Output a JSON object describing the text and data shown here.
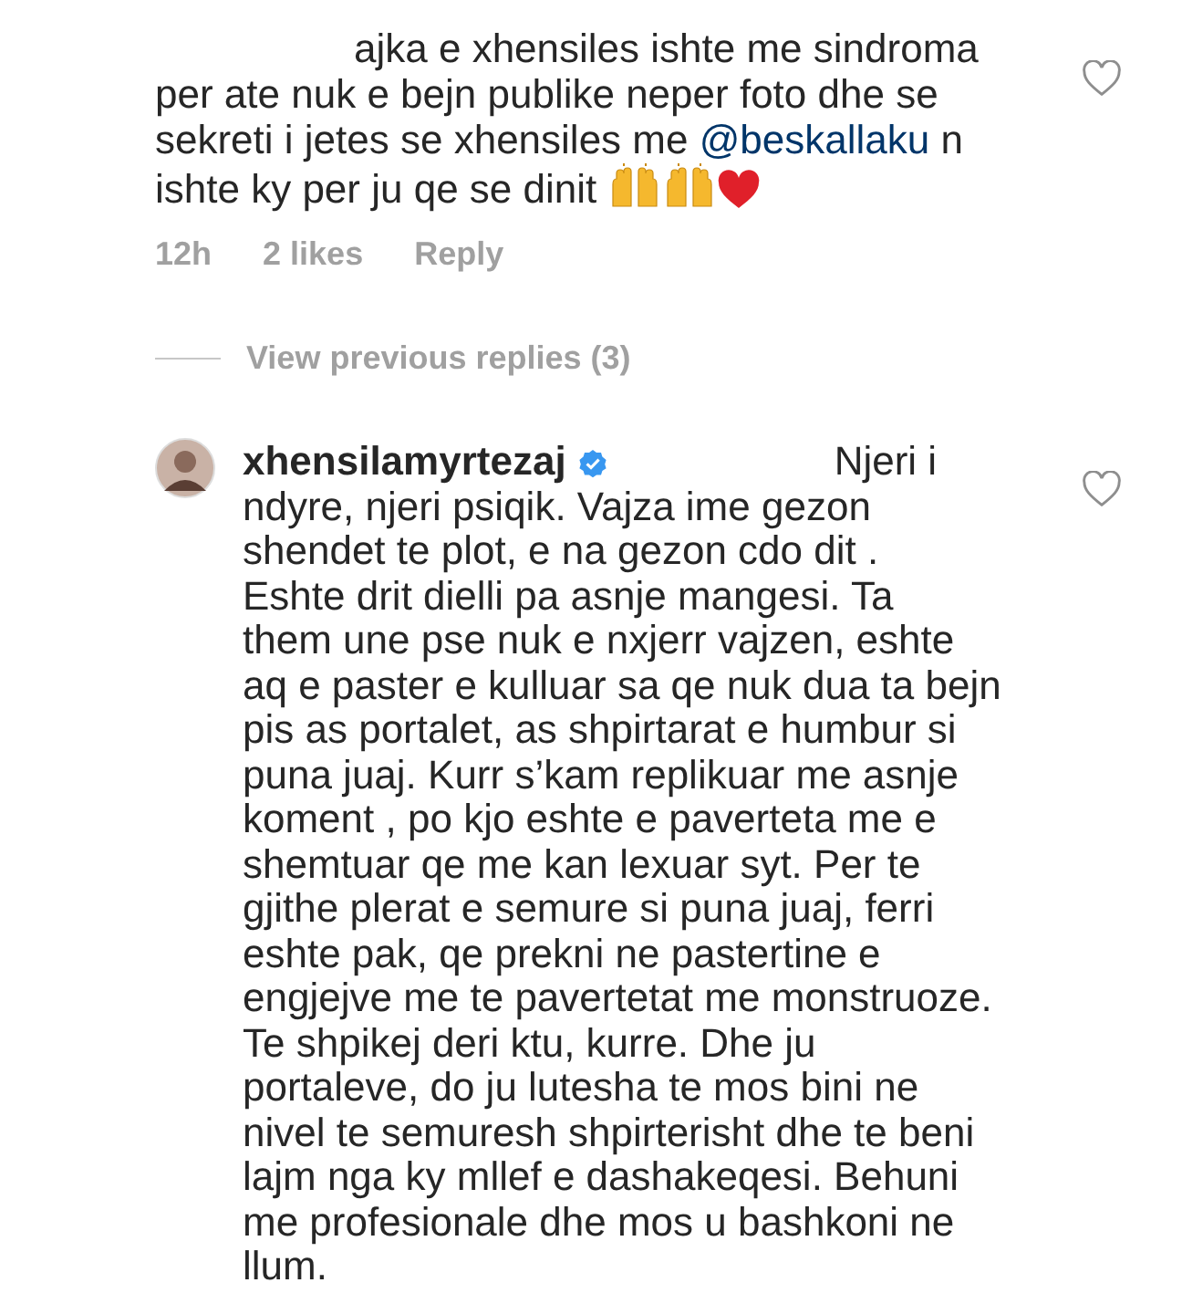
{
  "comment": {
    "text_before": "ajka e xhensiles ishte me sindroma\nper ate nuk e bejn publike neper foto dhe se\nsekreti i jetes se xhensiles me ",
    "mention": "@beskallaku",
    "text_after": " n\nishte ky per ju qe se dinit",
    "time": "12h",
    "likes": "2 likes",
    "reply_label": "Reply"
  },
  "view_replies": "View previous replies (3)",
  "reply": {
    "username": "xhensilamyrtezaj",
    "verified": true,
    "text": "Njeri i\nndyre, njeri psiqik. Vajza ime gezon\nshendet te plot,  e na gezon cdo dit .\nEshte drit dielli pa asnje mangesi.  Ta\nthem une pse nuk e nxjerr vajzen, eshte\naq e paster e kulluar sa qe nuk dua ta bejn\npis as portalet, as shpirtarat e humbur si\npuna juaj. Kurr s’kam replikuar me asnje\nkoment , po kjo eshte e paverteta me e\nshemtuar qe me kan lexuar syt. Per te\ngjithe plerat e semure si puna juaj, ferri\neshte pak, qe prekni ne pastertine e\nengjejve me te pavertetat me monstruoze.\nTe shpikej deri ktu, kurre. Dhe ju\nportaleve, do ju lutesha te mos bini ne\nnivel te semuresh shpirterisht dhe te beni\nlajm nga ky mllef e dashakeqesi. Behuni\nme profesionale dhe mos u bashkoni ne\nllum."
  }
}
